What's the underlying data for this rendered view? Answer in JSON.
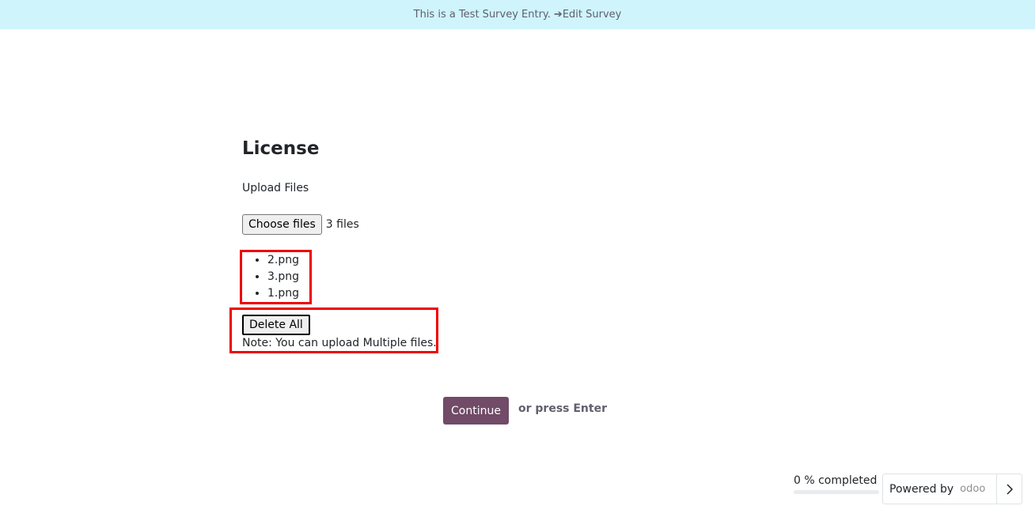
{
  "banner": {
    "text": "This is a Test Survey Entry.",
    "arrow": "➔",
    "edit_link": "Edit Survey"
  },
  "page": {
    "title": "License"
  },
  "question": {
    "label": "Upload Files",
    "choose_button": "Choose files",
    "file_count": "3 files",
    "files": [
      "2.png",
      "3.png",
      "1.png"
    ],
    "delete_button": "Delete All",
    "note": "Note: You can upload Multiple files."
  },
  "footer": {
    "continue_button": "Continue",
    "press_enter": "or press Enter",
    "progress_text": "0 % completed",
    "progress_fraction": 0,
    "powered_by": "Powered by",
    "brand_logo": "odoo",
    "next_icon": "chevron-right-icon"
  },
  "colors": {
    "banner_bg": "#cff4fc",
    "accent": "#714b67",
    "highlight": "#ee0000"
  }
}
